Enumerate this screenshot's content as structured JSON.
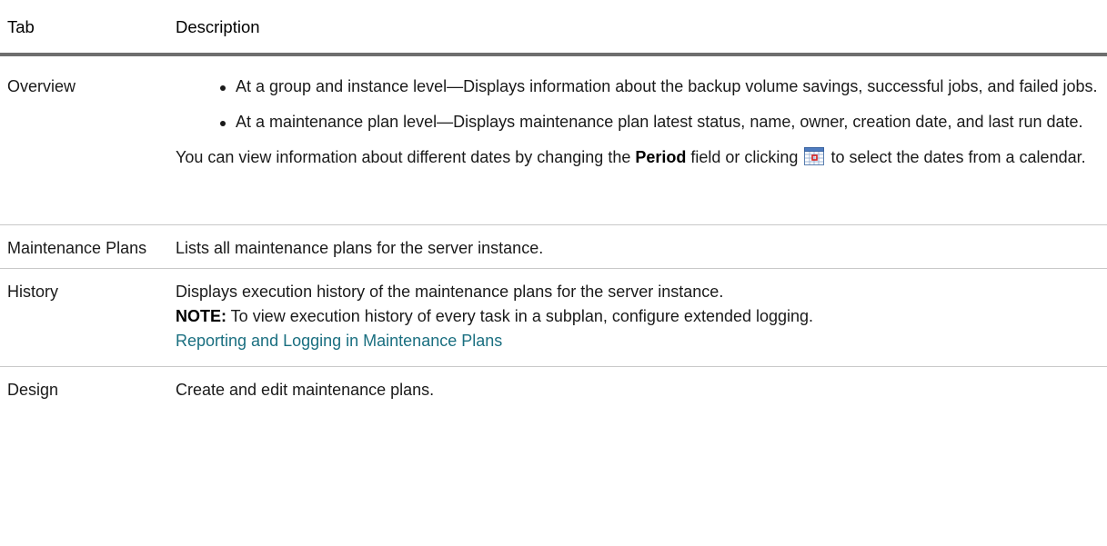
{
  "table": {
    "headers": {
      "tab": "Tab",
      "description": "Description"
    },
    "rows": {
      "overview": {
        "tab": "Overview",
        "bullets": [
          "At a group and instance level—Displays information about the backup volume savings, successful jobs, and failed jobs.",
          "At a maintenance plan level—Displays maintenance plan latest status, name, owner, creation date, and last run date."
        ],
        "para_before": "You can view information about different dates by changing the ",
        "para_strong": "Period",
        "para_middle": " field or clicking ",
        "para_after": " to select the dates from a calendar.",
        "icon": "calendar-icon"
      },
      "maintenance_plans": {
        "tab": "Maintenance Plans",
        "description": "Lists all maintenance plans for the server instance."
      },
      "history": {
        "tab": "History",
        "description": "Displays execution history of the maintenance plans for the server instance.",
        "note_label": "NOTE:",
        "note_text": " To view execution history of every task in a subplan, configure extended logging.",
        "link": "Reporting and Logging in Maintenance Plans"
      },
      "design": {
        "tab": "Design",
        "description": "Create and edit maintenance plans."
      }
    }
  },
  "colors": {
    "header_rule": "#6e6e6e",
    "row_rule": "#c9c9c9",
    "link": "#1a6f80"
  }
}
